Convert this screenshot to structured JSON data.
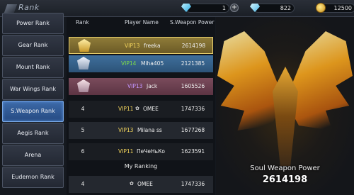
{
  "window": {
    "title": "Rank"
  },
  "currency": {
    "diamonds": "1",
    "bound_diamonds": "822",
    "gold": "12500"
  },
  "sidebar": {
    "items": [
      {
        "label": "Power Rank",
        "active": false
      },
      {
        "label": "Gear Rank",
        "active": false
      },
      {
        "label": "Mount Rank",
        "active": false
      },
      {
        "label": "War Wings Rank",
        "active": false
      },
      {
        "label": "S.Weapon Rank",
        "active": true
      },
      {
        "label": "Aegis Rank",
        "active": false
      },
      {
        "label": "Arena",
        "active": false
      },
      {
        "label": "Eudemon Rank",
        "active": false
      }
    ]
  },
  "table": {
    "headers": {
      "rank": "Rank",
      "player": "Player Name",
      "power": "S.Weapon Power"
    },
    "rows": [
      {
        "rank": "1",
        "vip": "VIP13",
        "name": "freeka",
        "power": "2614198"
      },
      {
        "rank": "2",
        "vip": "VIP14",
        "name": "Miha405",
        "power": "2121385"
      },
      {
        "rank": "3",
        "vip": "VIP13",
        "name": "Jack",
        "power": "1605526"
      },
      {
        "rank": "4",
        "vip": "VIP11",
        "name": "OMEE",
        "power": "1747336"
      },
      {
        "rank": "5",
        "vip": "VIP13",
        "name": "Milana ss",
        "power": "1677268"
      },
      {
        "rank": "6",
        "vip": "VIP11",
        "name": "ПеЧеНьКо",
        "power": "1623591"
      }
    ],
    "my_ranking_label": "My Ranking",
    "my_row": {
      "rank": "4",
      "name": "OMEE",
      "power": "1747336"
    }
  },
  "art": {
    "label": "Soul Weapon Power",
    "value": "2614198"
  },
  "colors": {
    "gold_row": "#8f7c39",
    "silver_row": "#3f6f9c",
    "bronze_row": "#7a4b5c",
    "active_tab": "#3d6aa8"
  }
}
